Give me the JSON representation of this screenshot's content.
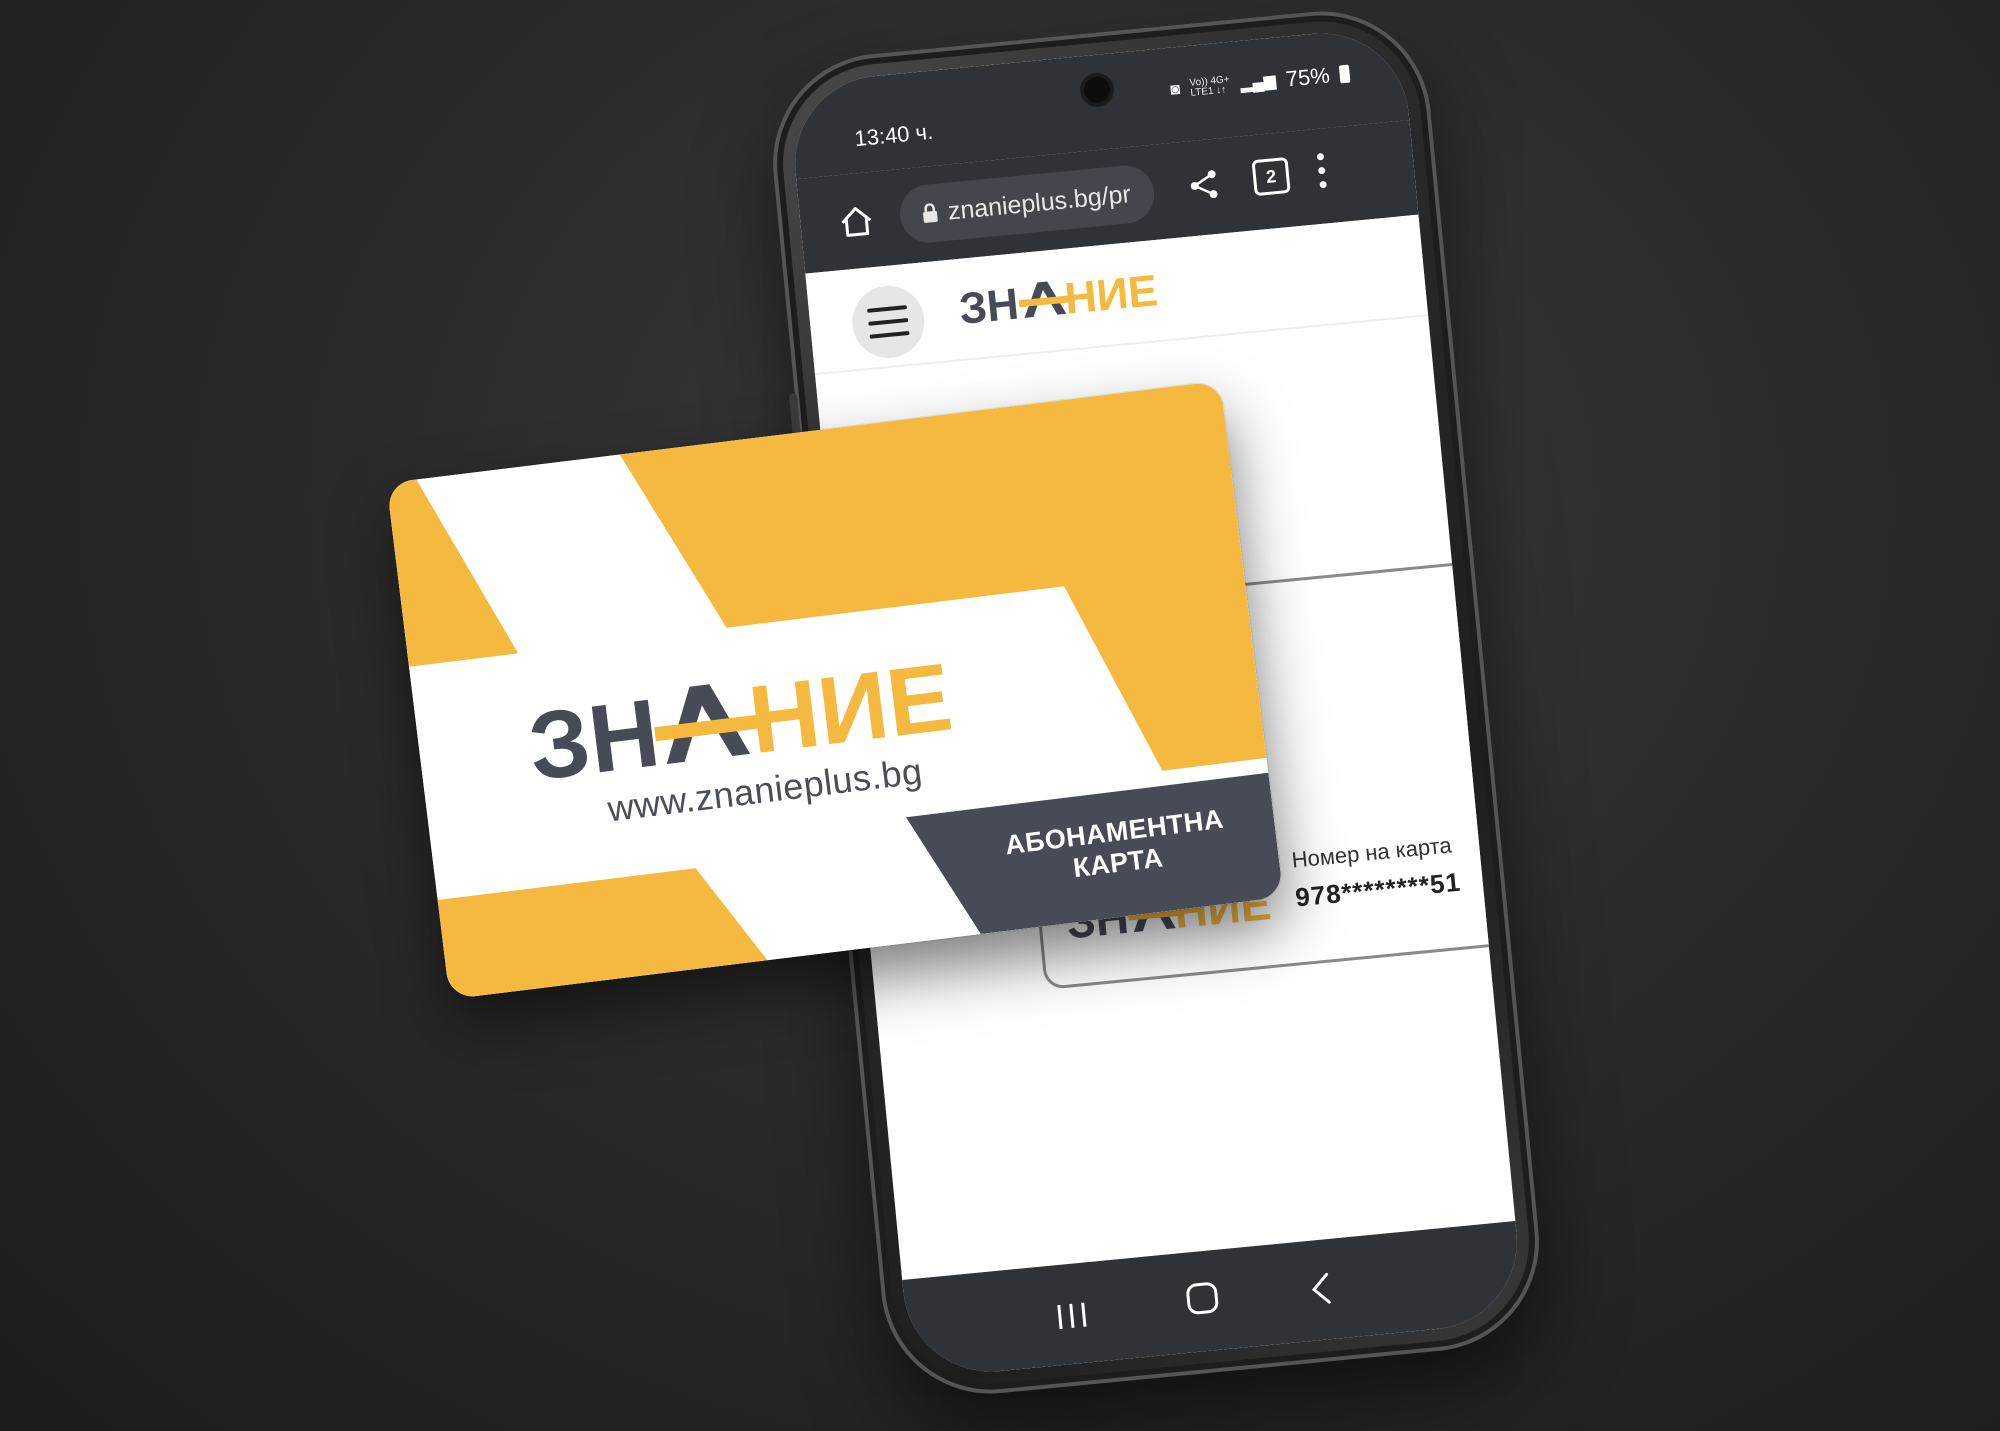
{
  "status_bar": {
    "time": "13:40 ч.",
    "network_top": "Vo)) 4G+",
    "network_bottom": "LTE1 ↓↑",
    "battery": "75%"
  },
  "browser": {
    "url": "znanieplus.bg/pr",
    "open_tabs": "2"
  },
  "brand": {
    "logo_left": "ЗН",
    "logo_right": "НИЕ",
    "dark_color": "#474b56",
    "accent_color": "#f6b940"
  },
  "screen_card": {
    "number_label": "Номер на карта",
    "number_value": "978********51"
  },
  "physical_card": {
    "website": "www.znanieplus.bg",
    "banner": "АБОНАМЕНТНА КАРТА"
  },
  "icons": [
    "home-icon",
    "lock-icon",
    "share-icon",
    "tabs-icon",
    "more-icon",
    "menu-icon",
    "recents-icon",
    "nav-home-icon",
    "back-icon"
  ]
}
